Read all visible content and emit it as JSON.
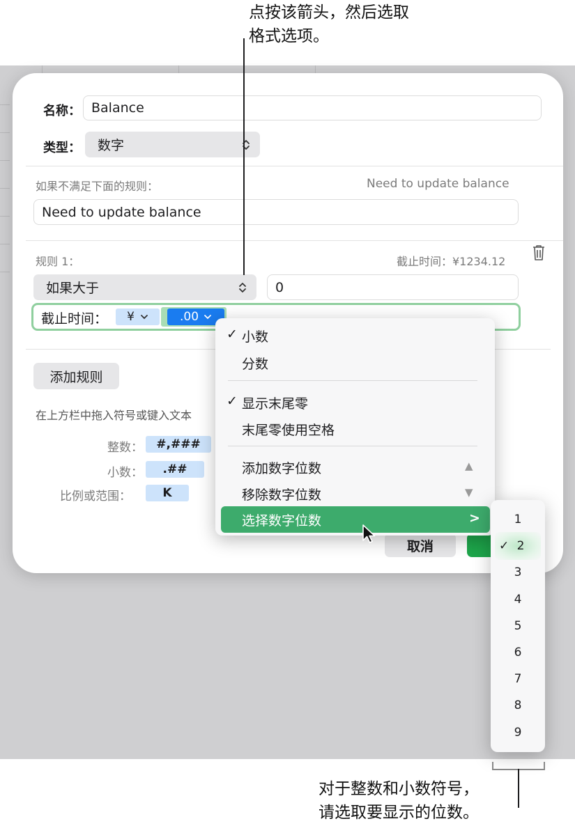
{
  "callouts": {
    "top_line1": "点按该箭头，然后选取",
    "top_line2": "格式选项。",
    "bottom_line1": "对于整数和小数符号，",
    "bottom_line2": "请选取要显示的位数。"
  },
  "dialog": {
    "name_label": "名称：",
    "name_value": "Balance",
    "type_label": "类型：",
    "type_value": "数字",
    "unmet_label": "如果不满足下面的规则：",
    "unmet_preview": "Need to update balance",
    "unmet_value": "Need to update balance",
    "rule_label": "规则 1：",
    "rule_preview": "截止时间：¥1234.12",
    "condition_value": "如果大于",
    "condition_number": "0",
    "format_prefix": "截止时间：",
    "currency_token": "¥",
    "decimal_token": ".00",
    "add_rule_label": "添加规则",
    "hint_text": "在上方栏中拖入符号或键入文本",
    "integer_label": "整数：",
    "integer_token": "#,###",
    "decimal_label": "小数：",
    "decimal_token2": ".##",
    "scale_label": "比例或范围：",
    "scale_token": "K",
    "cancel_label": "取消"
  },
  "menu": {
    "items": [
      {
        "label": "小数",
        "checked": true
      },
      {
        "label": "分数",
        "checked": false
      },
      {
        "label": "显示末尾零",
        "checked": true
      },
      {
        "label": "末尾零使用空格",
        "checked": false
      },
      {
        "label": "添加数字位数",
        "checked": false
      },
      {
        "label": "移除数字位数",
        "checked": false
      },
      {
        "label": "选择数字位数",
        "checked": false
      }
    ],
    "check_glyph": "✓",
    "up_glyph": "▲",
    "down_glyph": "▼",
    "submenu_glyph": ">"
  },
  "digits_menu": {
    "items": [
      "1",
      "2",
      "3",
      "4",
      "5",
      "6",
      "7",
      "8",
      "9"
    ],
    "selected": "2"
  },
  "colors": {
    "highlight_green": "#3dab6c",
    "token_blue": "#cde3fb",
    "selected_token_blue": "#1a7cf0",
    "format_border_green": "#8fcf9e"
  }
}
